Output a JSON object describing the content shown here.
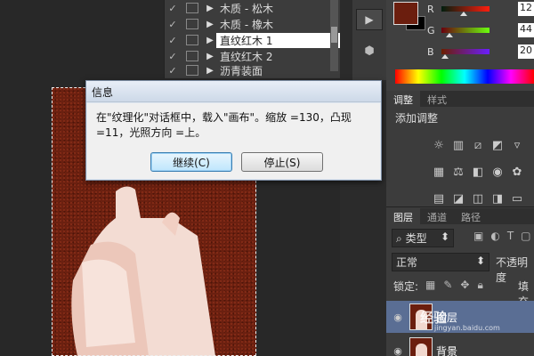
{
  "layers_top": {
    "items": [
      {
        "checked": true,
        "label": "木质 - 松木",
        "selected": false
      },
      {
        "checked": true,
        "label": "木质 - 橡木",
        "selected": false
      },
      {
        "checked": true,
        "label": "直纹红木 1",
        "selected": true
      },
      {
        "checked": true,
        "label": "直纹红木 2",
        "selected": false
      },
      {
        "checked": true,
        "label": "沥青装面",
        "selected": false
      }
    ]
  },
  "color": {
    "foreground": "#6b1e0e",
    "background": "#000000",
    "channels": [
      {
        "name": "R",
        "value": "12",
        "fraction": 0.47,
        "gradient_from": "#001e0e",
        "gradient_to": "#ff1e0e"
      },
      {
        "name": "G",
        "value": "44",
        "fraction": 0.17,
        "gradient_from": "#6b000e",
        "gradient_to": "#6bff0e"
      },
      {
        "name": "B",
        "value": "20",
        "fraction": 0.08,
        "gradient_from": "#6b1e00",
        "gradient_to": "#6b1eff"
      }
    ]
  },
  "adjustments": {
    "tabs": [
      "调整",
      "样式"
    ],
    "active_tab": "调整",
    "title": "添加调整",
    "icons": [
      "brightness-icon",
      "levels-icon",
      "curves-icon",
      "exposure-icon",
      "vibrance-icon",
      "hue-saturation-icon",
      "color-balance-icon",
      "black-white-icon",
      "photo-filter-icon",
      "channel-mixer-icon",
      "color-lookup-icon",
      "invert-icon",
      "posterize-icon",
      "threshold-icon",
      "gradient-map-icon"
    ]
  },
  "layers": {
    "tabs": [
      "图层",
      "通道",
      "路径"
    ],
    "active_tab": "图层",
    "filter_kind": "类型",
    "blend_mode": "正常",
    "opacity_label": "不透明度",
    "lock_label": "锁定:",
    "fill_label": "填充",
    "rows": [
      {
        "name": "图层",
        "selected": true
      },
      {
        "name": "背景",
        "selected": false
      }
    ]
  },
  "watermark": {
    "text": "经验",
    "url": "jingyan.baidu.com"
  },
  "dialog": {
    "title": "信息",
    "message": "在\"纹理化\"对话框中，载入\"画布\"。缩放 =130，凸现 =11，光照方向 =上。",
    "continue_label": "继续(C)",
    "stop_label": "停止(S)"
  }
}
